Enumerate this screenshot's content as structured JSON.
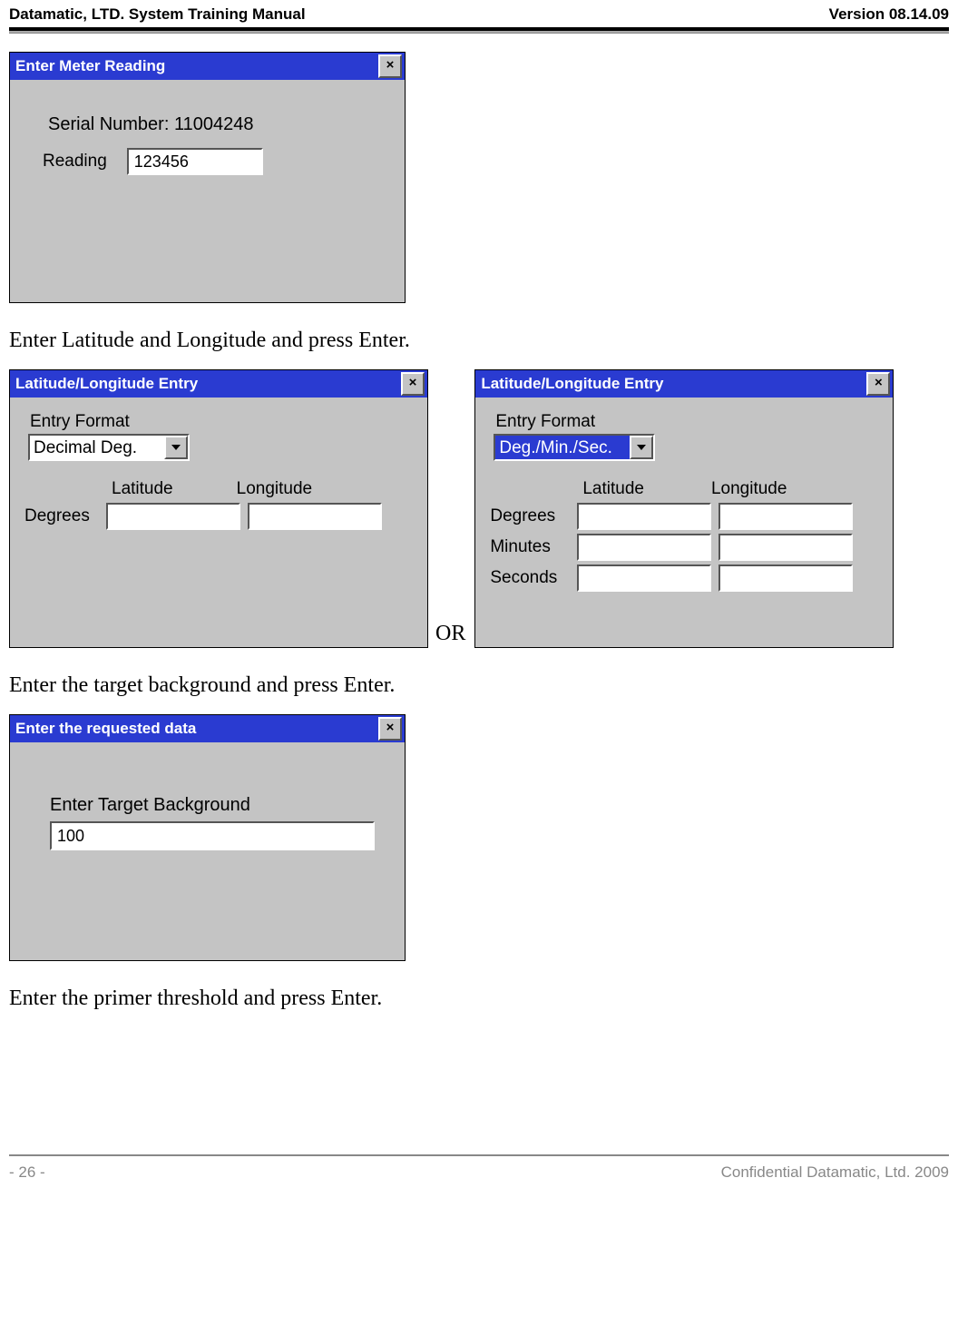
{
  "header": {
    "left": "Datamatic, LTD. System Training  Manual",
    "right": "Version 08.14.09"
  },
  "dialog1": {
    "title": "Enter Meter Reading",
    "close": "×",
    "serial_label": "Serial Number:",
    "serial_value": "11004248",
    "reading_label": "Reading",
    "reading_value": "123456"
  },
  "text1": "Enter Latitude and Longitude and press Enter.",
  "dialog2": {
    "title": "Latitude/Longitude Entry",
    "close": "×",
    "format_label": "Entry Format",
    "format_value": "Decimal Deg.",
    "lat_header": "Latitude",
    "lon_header": "Longitude",
    "deg_label": "Degrees"
  },
  "or_text": "OR",
  "dialog3": {
    "title": "Latitude/Longitude Entry",
    "close": "×",
    "format_label": "Entry Format",
    "format_value": "Deg./Min./Sec.",
    "lat_header": "Latitude",
    "lon_header": "Longitude",
    "deg_label": "Degrees",
    "min_label": "Minutes",
    "sec_label": "Seconds"
  },
  "text2": "Enter the target background and press Enter.",
  "dialog4": {
    "title": "Enter the requested data",
    "close": "×",
    "target_label": "Enter Target Background",
    "target_value": "100"
  },
  "text3": "Enter the primer threshold and press Enter.",
  "footer": {
    "left": "- 26 -",
    "right": "Confidential Datamatic, Ltd. 2009"
  }
}
